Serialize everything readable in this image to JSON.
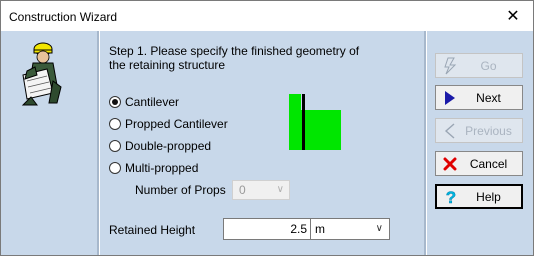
{
  "window": {
    "title": "Construction Wizard",
    "close_glyph": "✕"
  },
  "instructions": "Step 1. Please specify the finished geometry of the retaining structure",
  "options": [
    {
      "label": "Cantilever",
      "checked": true
    },
    {
      "label": "Propped Cantilever",
      "checked": false
    },
    {
      "label": "Double-propped",
      "checked": false
    },
    {
      "label": "Multi-propped",
      "checked": false
    }
  ],
  "props": {
    "label": "Number of Props",
    "value": "0"
  },
  "retained_height": {
    "label": "Retained Height",
    "value": "2.5",
    "unit": "m"
  },
  "buttons": {
    "go": {
      "label": "Go",
      "icon": "lightning-icon",
      "enabled": false
    },
    "next": {
      "label": "Next",
      "icon": "right-arrow-icon",
      "enabled": true
    },
    "previous": {
      "label": "Previous",
      "icon": "left-arrow-icon",
      "enabled": false
    },
    "cancel": {
      "label": "Cancel",
      "icon": "red-x-icon",
      "enabled": true
    },
    "help": {
      "label": "Help",
      "icon": "question-mark-icon",
      "enabled": true
    }
  },
  "colors": {
    "panel": "#c8d8ea",
    "wall_green": "#00e600",
    "wall_black": "#000000",
    "next_arrow": "#1a1aa8",
    "cancel_x": "#e00000",
    "help_q": "#00b8e0"
  }
}
